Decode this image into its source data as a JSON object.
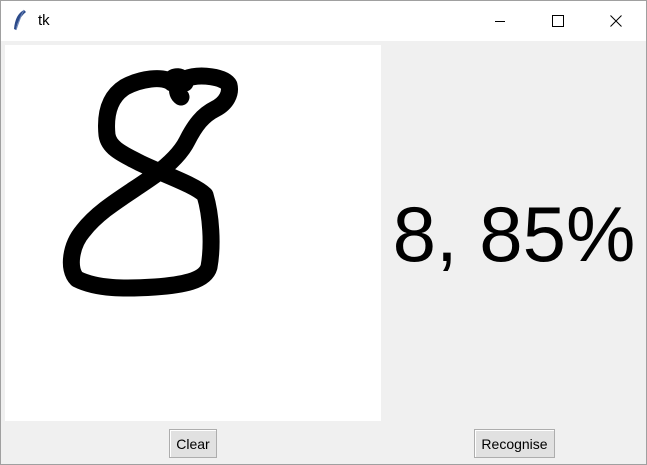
{
  "window": {
    "title": "tk",
    "icons": {
      "app": "feather-icon",
      "minimize": "minimize-icon",
      "maximize": "maximize-icon",
      "close": "close-icon"
    }
  },
  "canvas": {
    "drawn_digit": "8"
  },
  "prediction": {
    "text": "8, 85%"
  },
  "buttons": {
    "clear": "Clear",
    "recognise": "Recognise"
  }
}
